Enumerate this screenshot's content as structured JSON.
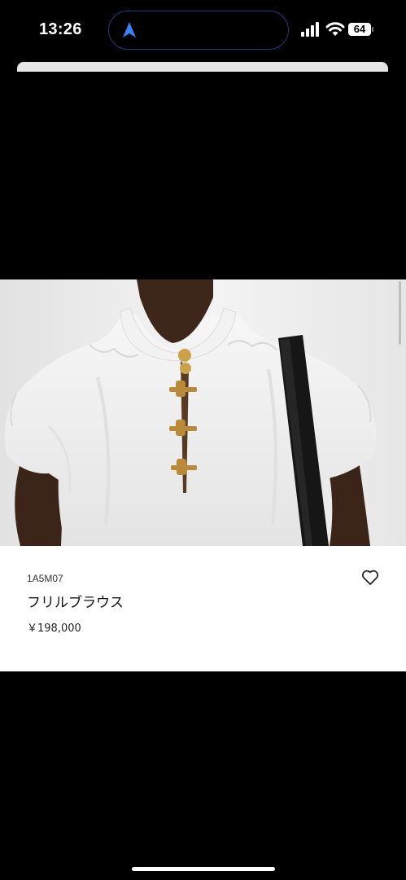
{
  "status_bar": {
    "time": "13:26",
    "battery": "64"
  },
  "product": {
    "sku": "1A5M07",
    "name": "フリルブラウス",
    "price": "￥198,000"
  },
  "icons": {
    "location": "navigation-arrow-icon",
    "signal": "cellular-signal-icon",
    "wifi": "wifi-icon",
    "battery": "battery-icon",
    "wishlist": "heart-outline-icon"
  },
  "colors": {
    "background": "#000000",
    "card": "#ffffff",
    "accent": "#3b82f6"
  }
}
